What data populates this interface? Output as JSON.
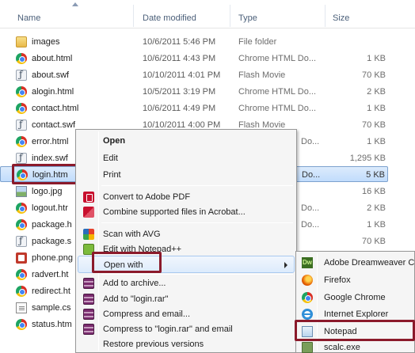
{
  "header": {
    "name": "Name",
    "date_modified": "Date modified",
    "type": "Type",
    "size": "Size"
  },
  "files": [
    {
      "name": "images",
      "date": "10/6/2011 5:46 PM",
      "type": "File folder",
      "size": "",
      "icon": "folder-icon"
    },
    {
      "name": "about.html",
      "date": "10/6/2011 4:43 PM",
      "type": "Chrome HTML Do...",
      "size": "1 KB",
      "icon": "chrome-icon"
    },
    {
      "name": "about.swf",
      "date": "10/10/2011 4:01 PM",
      "type": "Flash Movie",
      "size": "70 KB",
      "icon": "flash-icon"
    },
    {
      "name": "alogin.html",
      "date": "10/5/2011 3:19 PM",
      "type": "Chrome HTML Do...",
      "size": "2 KB",
      "icon": "chrome-icon"
    },
    {
      "name": "contact.html",
      "date": "10/6/2011 4:49 PM",
      "type": "Chrome HTML Do...",
      "size": "1 KB",
      "icon": "chrome-icon"
    },
    {
      "name": "contact.swf",
      "date": "10/10/2011 4:00 PM",
      "type": "Flash Movie",
      "size": "70 KB",
      "icon": "flash-icon"
    },
    {
      "name": "error.html",
      "date": "",
      "type": "Do...",
      "size": "1 KB",
      "icon": "chrome-icon"
    },
    {
      "name": "index.swf",
      "date": "",
      "type": "",
      "size": "1,295 KB",
      "icon": "flash-icon"
    },
    {
      "name": "login.htm",
      "date": "",
      "type": "Do...",
      "size": "5 KB",
      "icon": "chrome-icon"
    },
    {
      "name": "logo.jpg",
      "date": "",
      "type": "",
      "size": "16 KB",
      "icon": "image-icon"
    },
    {
      "name": "logout.htr",
      "date": "",
      "type": "Do...",
      "size": "2 KB",
      "icon": "chrome-icon"
    },
    {
      "name": "package.h",
      "date": "",
      "type": "Do...",
      "size": "1 KB",
      "icon": "chrome-icon"
    },
    {
      "name": "package.s",
      "date": "",
      "type": "",
      "size": "70 KB",
      "icon": "flash-icon"
    },
    {
      "name": "phone.png",
      "date": "",
      "type": "",
      "size": "",
      "icon": "php-icon"
    },
    {
      "name": "radvert.ht",
      "date": "",
      "type": "",
      "size": "",
      "icon": "chrome-icon"
    },
    {
      "name": "redirect.ht",
      "date": "",
      "type": "",
      "size": "",
      "icon": "chrome-icon"
    },
    {
      "name": "sample.cs",
      "date": "",
      "type": "",
      "size": "",
      "icon": "doc-icon"
    },
    {
      "name": "status.htm",
      "date": "",
      "type": "",
      "size": "",
      "icon": "chrome-icon"
    }
  ],
  "context_menu": {
    "open": "Open",
    "edit": "Edit",
    "print": "Print",
    "convert_pdf": "Convert to Adobe PDF",
    "combine_acrobat": "Combine supported files in Acrobat...",
    "scan_avg": "Scan with AVG",
    "edit_npp": "Edit with Notepad++",
    "open_with": "Open with",
    "add_archive": "Add to archive...",
    "add_rar": "Add to \"login.rar\"",
    "compress_email": "Compress and email...",
    "compress_rar_email": "Compress to \"login.rar\" and email",
    "restore": "Restore previous versions"
  },
  "open_with_submenu": {
    "dreamweaver": "Adobe Dreamweaver C",
    "dreamweaver_icon_text": "Dw",
    "firefox": "Firefox",
    "chrome": "Google Chrome",
    "ie": "Internet Explorer",
    "notepad": "Notepad",
    "scalc": "scalc.exe"
  },
  "colors": {
    "highlight_box": "#8b1a2b",
    "selection": "#c1dcfc"
  }
}
